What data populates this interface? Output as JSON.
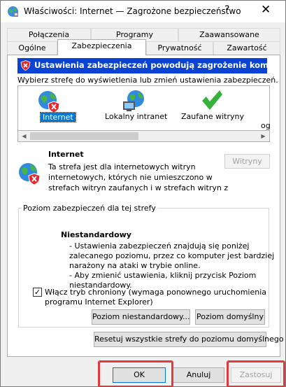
{
  "window": {
    "title": "Właściwości: Internet — Zagrożone bezpieczeństwo",
    "help": "?",
    "close": "✕"
  },
  "tabs_top": [
    "Połączenia",
    "Programy",
    "Zaawansowane"
  ],
  "tabs_bottom": [
    "Ogólne",
    "Zabezpieczenia",
    "Prywatność",
    "Zawartość"
  ],
  "active_tab": "Zabezpieczenia",
  "warning": "Ustawienia zabezpieczeń powodują zagrożenie komputera.",
  "zone_prompt": "Wybierz strefę do wyświetlenia lub zmień ustawienia zabezpieczeń.",
  "zones": [
    {
      "label": "Internet",
      "icon": "globe-warning-icon",
      "selected": true
    },
    {
      "label": "Lokalny intranet",
      "icon": "intranet-globe-icon"
    },
    {
      "label": "Zaufane witryny",
      "icon": "checkmark-icon"
    },
    {
      "label": "og",
      "icon": ""
    }
  ],
  "zone_info": {
    "title": "Internet",
    "description": [
      "Ta strefa jest dla internetowych witryn",
      "internetowych, których nie umieszczono w",
      "strefach witryn zaufanych i w strefach witryn z"
    ],
    "sites_button": "Witryny"
  },
  "security_level": {
    "legend": "Poziom zabezpieczeń dla tej strefy",
    "level_name": "Niestandardowy",
    "details": [
      "- Ustawienia zabezpieczeń znajdują się poniżej",
      "zalecanego poziomu, przez co komputer jest bardziej",
      "narażony na ataki w trybie online.",
      "- Aby zmienić ustawienia, kliknij przycisk Poziom",
      "niestandardowy."
    ],
    "protected_mode_checked": true,
    "checkmark": "✓",
    "protected_mode_label": [
      "Włącz tryb chroniony (wymaga ponownego uruchomienia",
      "programu Internet Explorer)"
    ],
    "custom_level_button": "Poziom niestandardowy...",
    "default_level_button": "Poziom domyślny",
    "reset_button": "Resetuj wszystkie strefy do poziomu domyślnego"
  },
  "footer": {
    "ok": "OK",
    "cancel": "Anuluj",
    "apply": "Zastosuj"
  },
  "colors": {
    "warning_bar": "#0a43d4",
    "selection": "#0078d7",
    "highlight_border": "#e0393e"
  }
}
